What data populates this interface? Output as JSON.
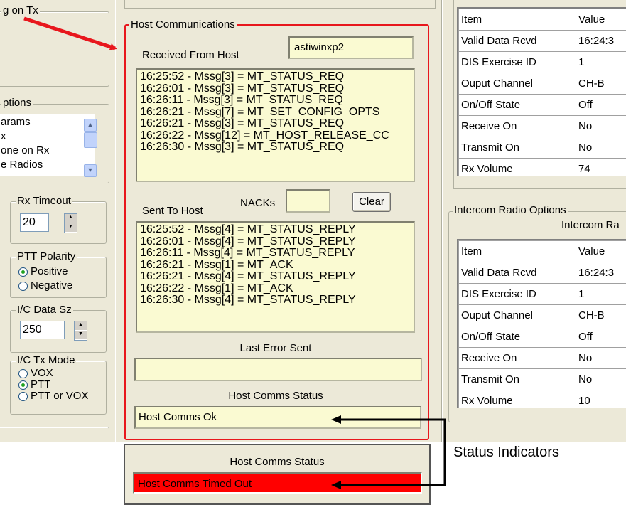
{
  "left_panel": {
    "top_group_title": "g on Tx",
    "options_title": "ptions",
    "options_items": [
      "arams",
      "x",
      "one on Rx",
      "e Radios"
    ],
    "rx_timeout": {
      "title": "Rx Timeout",
      "value": "20"
    },
    "ptt_polarity": {
      "title": "PTT Polarity",
      "options": [
        "Positive",
        "Negative"
      ],
      "selected": "Positive"
    },
    "ic_data_size": {
      "title": "I/C Data Sz",
      "value": "250"
    },
    "ic_tx_mode": {
      "title": "I/C Tx Mode",
      "options": [
        "VOX",
        "PTT",
        "PTT or VOX"
      ],
      "selected": "PTT"
    }
  },
  "host_comms": {
    "title": "Host Communications",
    "received_label": "Received From Host",
    "host_name": "astiwinxp2",
    "received_messages": [
      "16:25:52  - Mssg[3] = MT_STATUS_REQ",
      "16:26:01  - Mssg[3] = MT_STATUS_REQ",
      "16:26:11  - Mssg[3] = MT_STATUS_REQ",
      "16:26:21  - Mssg[7] = MT_SET_CONFIG_OPTS",
      "16:26:21  - Mssg[3] = MT_STATUS_REQ",
      "16:26:22  - Mssg[12] = MT_HOST_RELEASE_CC",
      "16:26:30  - Mssg[3] = MT_STATUS_REQ"
    ],
    "nacks_label": "NACKs",
    "nacks_value": "",
    "clear_label": "Clear",
    "sent_label": "Sent To Host",
    "sent_messages": [
      "16:25:52  - Mssg[4] = MT_STATUS_REPLY",
      "16:26:01  - Mssg[4] = MT_STATUS_REPLY",
      "16:26:11  - Mssg[4] = MT_STATUS_REPLY",
      "16:26:21  - Mssg[1] = MT_ACK",
      "16:26:21  - Mssg[4] = MT_STATUS_REPLY",
      "16:26:22  - Mssg[1] = MT_ACK",
      "16:26:30  - Mssg[4] = MT_STATUS_REPLY"
    ],
    "last_error_label": "Last Error Sent",
    "last_error_value": "",
    "status_label": "Host Comms Status",
    "status_value": "Host Comms Ok"
  },
  "status_example": {
    "label": "Host Comms Status",
    "value": "Host Comms Timed Out",
    "value_bg": "#ff0000"
  },
  "annotation": {
    "label": "Status Indicators",
    "arrow_color": "#e8171d"
  },
  "top_table": {
    "headers": [
      "Item",
      "Value"
    ],
    "rows": [
      [
        "Valid Data Rcvd",
        "16:24:3"
      ],
      [
        "DIS Exercise ID",
        "1"
      ],
      [
        "Ouput Channel",
        "CH-B"
      ],
      [
        "On/Off State",
        "Off"
      ],
      [
        "Receive On",
        "No"
      ],
      [
        "Transmit On",
        "No"
      ],
      [
        "Rx Volume",
        "74"
      ]
    ]
  },
  "intercom": {
    "group_title": "Intercom Radio Options",
    "subtitle": "Intercom Ra",
    "headers": [
      "Item",
      "Value"
    ],
    "rows": [
      [
        "Valid Data Rcvd",
        "16:24:3"
      ],
      [
        "DIS Exercise ID",
        "1"
      ],
      [
        "Ouput Channel",
        "CH-B"
      ],
      [
        "On/Off State",
        "Off"
      ],
      [
        "Receive On",
        "No"
      ],
      [
        "Transmit On",
        "No"
      ],
      [
        "Rx Volume",
        "10"
      ]
    ]
  },
  "colors": {
    "red_outline": "#e8171d",
    "listbox_bg": "#fafad2",
    "window_bg": "#ece9d8"
  }
}
